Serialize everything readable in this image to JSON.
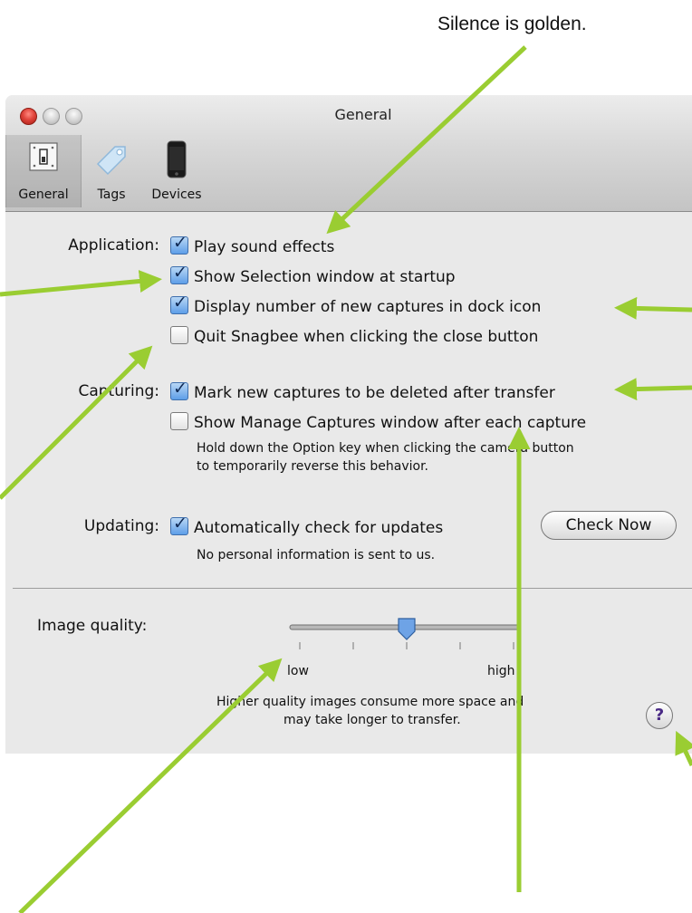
{
  "caption": "Silence is golden.",
  "window": {
    "title": "General",
    "toolbar": [
      {
        "label": "General",
        "icon": "switch-icon"
      },
      {
        "label": "Tags",
        "icon": "tag-icon"
      },
      {
        "label": "Devices",
        "icon": "phone-icon"
      }
    ]
  },
  "application": {
    "label": "Application:",
    "options": [
      {
        "label": "Play sound effects",
        "checked": true
      },
      {
        "label": "Show Selection window at startup",
        "checked": true
      },
      {
        "label": "Display number of new captures in dock icon",
        "checked": true
      },
      {
        "label": "Quit Snagbee when clicking the close button",
        "checked": false
      }
    ]
  },
  "capturing": {
    "label": "Capturing:",
    "options": [
      {
        "label": "Mark new captures to be deleted after transfer",
        "checked": true
      },
      {
        "label": "Show Manage Captures window after each capture",
        "checked": false
      }
    ],
    "note_line1": "Hold down the Option key when clicking the camera button",
    "note_line2": "to temporarily reverse this behavior."
  },
  "updating": {
    "label": "Updating:",
    "option": {
      "label": "Automatically check for updates",
      "checked": true
    },
    "note": "No personal information is sent to us.",
    "button": "Check Now"
  },
  "quality": {
    "label": "Image quality:",
    "min_label": "low",
    "max_label": "high",
    "value_fraction": 0.5,
    "note_line1": "Higher quality images consume more space and",
    "note_line2": "may take longer to transfer."
  },
  "help_symbol": "?",
  "colors": {
    "arrow": "#9acd32",
    "checkbox_blue": "#5e9ee8",
    "help_purple": "#4a2a86"
  }
}
